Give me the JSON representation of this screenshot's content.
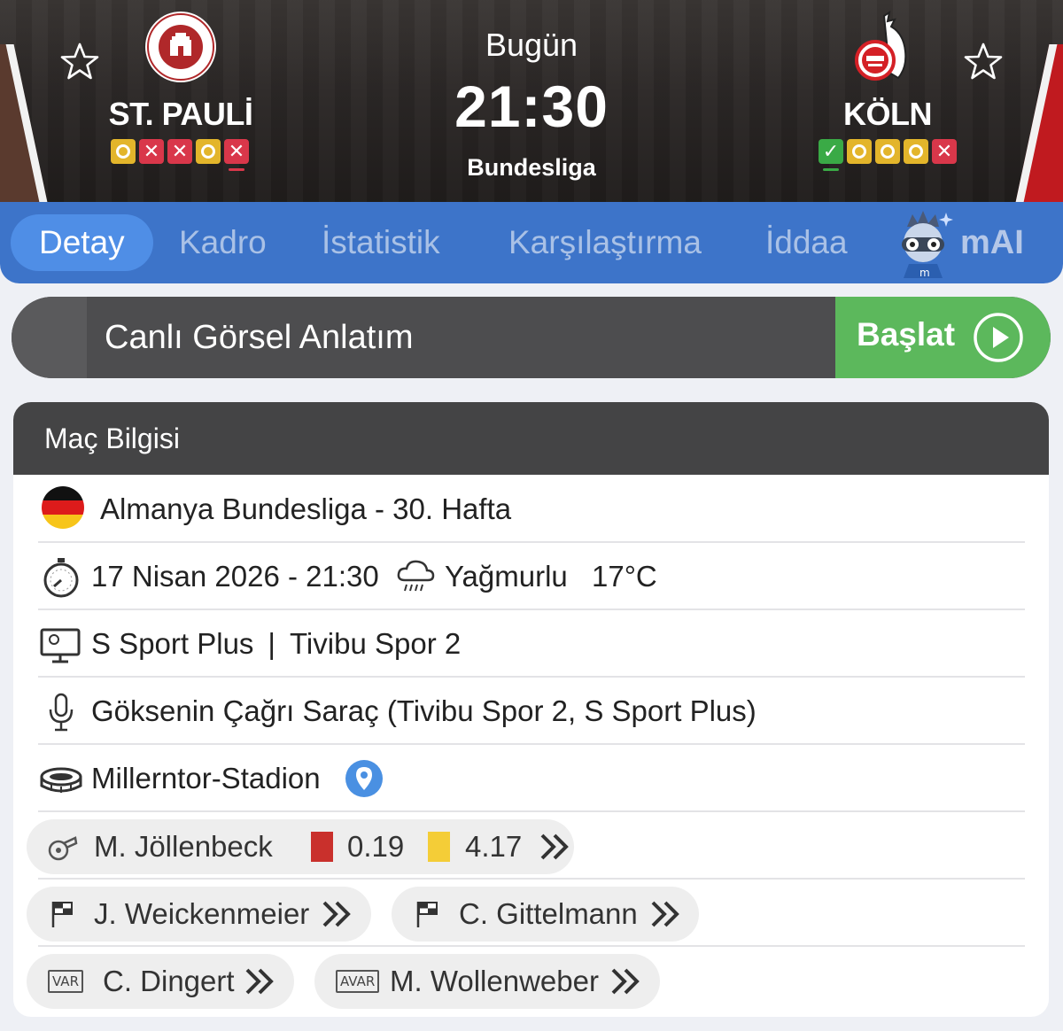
{
  "match": {
    "home": {
      "name": "ST. PAULİ",
      "form": [
        "D",
        "L",
        "L",
        "D",
        "L"
      ]
    },
    "away": {
      "name": "KÖLN",
      "form": [
        "W",
        "D",
        "D",
        "D",
        "L"
      ]
    },
    "day": "Bugün",
    "time": "21:30",
    "competition": "Bundesliga"
  },
  "colors": {
    "draw": "#e3b52b",
    "loss": "#d9374a",
    "win": "#3aaa46",
    "tabs_bg": "#3d74c9",
    "start_green": "#5cb85c"
  },
  "tabs": [
    {
      "label": "Detay",
      "active": true
    },
    {
      "label": "Kadro"
    },
    {
      "label": "İstatistik"
    },
    {
      "label": "Karşılaştırma"
    },
    {
      "label": "İddaa"
    },
    {
      "label": "mAI",
      "icon": "mascot-icon"
    }
  ],
  "live": {
    "title": "Canlı Görsel Anlatım",
    "start_label": "Başlat"
  },
  "info": {
    "title": "Maç Bilgisi",
    "league": "Almanya Bundesliga - 30. Hafta",
    "datetime": "17 Nisan 2026 - 21:30",
    "weather": "Yağmurlu",
    "temperature": "17°C",
    "channel_1": "S Sport Plus",
    "channel_sep": "|",
    "channel_2": "Tivibu Spor 2",
    "commentator": "Göksenin Çağrı Saraç (Tivibu Spor 2, S Sport Plus)",
    "stadium": "Millerntor-Stadion"
  },
  "officials": {
    "referee": {
      "name": "M. Jöllenbeck",
      "red_avg": "0.19",
      "yellow_avg": "4.17",
      "icon": "whistle-icon"
    },
    "assistant_1": {
      "name": "J. Weickenmeier",
      "icon": "flag-icon"
    },
    "assistant_2": {
      "name": "C. Gittelmann",
      "icon": "flag-icon"
    },
    "var": {
      "badge": "VAR",
      "name": "C. Dingert"
    },
    "avar": {
      "badge": "AVAR",
      "name": "M. Wollenweber"
    }
  }
}
